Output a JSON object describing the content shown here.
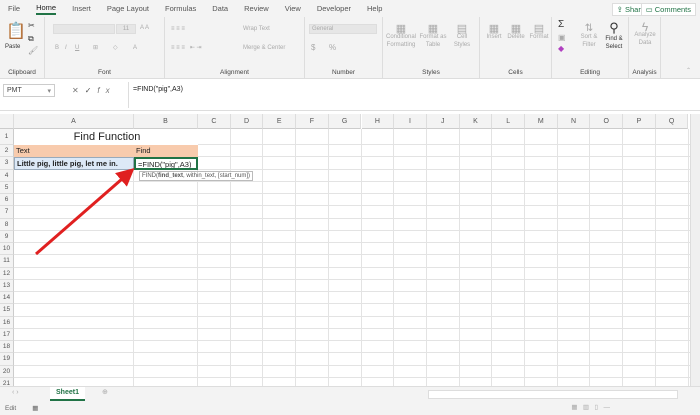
{
  "tabs": [
    "File",
    "Home",
    "Insert",
    "Page Layout",
    "Formulas",
    "Data",
    "Review",
    "View",
    "Developer",
    "Help"
  ],
  "share": "Share",
  "comments": "Comments",
  "ribbon": {
    "clipboard": {
      "paste": "Paste",
      "label": "Clipboard"
    },
    "font": {
      "label": "Font",
      "size": "11",
      "bold": "B",
      "italic": "I",
      "underline": "U"
    },
    "alignment": {
      "wrap": "Wrap Text",
      "merge": "Merge & Center",
      "label": "Alignment"
    },
    "number": {
      "format": "General",
      "currency": "$",
      "percent": "%",
      "label": "Number"
    },
    "styles": {
      "conditional": "Conditional Formatting",
      "format_table": "Format as Table",
      "cell_styles": "Cell Styles",
      "label": "Styles"
    },
    "cells": {
      "insert": "Insert",
      "delete": "Delete",
      "format": "Format",
      "label": "Cells"
    },
    "editing": {
      "sum": "Σ",
      "sort": "Sort & Filter",
      "find": "Find & Select",
      "label": "Editing"
    },
    "analysis": {
      "analyze": "Analyze Data",
      "label": "Analysis"
    }
  },
  "formula_bar": {
    "name_box": "PMT",
    "cancel": "✕",
    "enter": "✓",
    "fx": "fx",
    "formula": "=FIND(\"pig\",A3)"
  },
  "columns": [
    "A",
    "B",
    "C",
    "D",
    "E",
    "F",
    "G",
    "H",
    "I",
    "J",
    "K",
    "L",
    "M",
    "N",
    "O",
    "P",
    "Q"
  ],
  "rows": [
    "1",
    "2",
    "3",
    "4",
    "5",
    "6",
    "7",
    "8",
    "9",
    "10",
    "11",
    "12",
    "13",
    "14",
    "15",
    "16",
    "17",
    "18",
    "19",
    "20",
    "21"
  ],
  "cells": {
    "title": "Find Function",
    "a2": "Text",
    "b2": "Find",
    "a3": "Little pig, little pig, let me in.",
    "b3": "=FIND(\"pig\",A3)"
  },
  "tooltip": {
    "fn": "FIND(",
    "arg1": "find_text",
    ",rest": ", within_text, [start_num])"
  },
  "sheets": [
    "Sheet1"
  ],
  "status": "Edit",
  "colors": {
    "accent": "#217346",
    "header_fill": "#f8cbad",
    "selected_fill": "#dde9f7",
    "arrow": "#e02020"
  }
}
